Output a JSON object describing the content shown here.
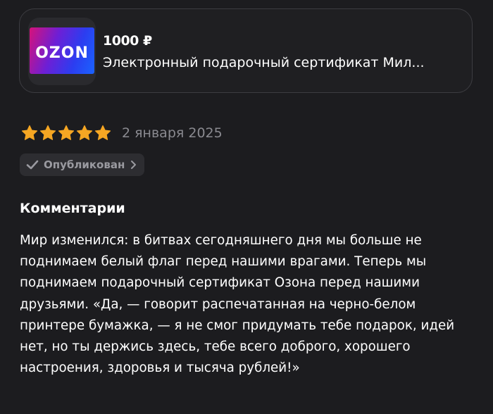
{
  "product": {
    "logo_text": "OZON",
    "price": "1000 ₽",
    "title": "Электронный подарочный сертификат Мил..."
  },
  "review": {
    "rating": 5,
    "rating_max": 5,
    "star_color": "#f5a623",
    "date": "2 января 2025",
    "status": {
      "icon": "check-icon",
      "label": "Опубликован",
      "arrow": "chevron-right-icon"
    }
  },
  "comments": {
    "heading": "Комментарии",
    "text": "Мир изменился: в битвах сегодняшнего дня мы больше не поднимаем белый флаг перед нашими врагами. Теперь мы поднимаем подарочный сертификат Озона перед нашими друзьями. «Да, — говорит распечатанная на черно-белом принтере бумажка, — я не смог придумать тебе подарок, идей нет, но ты держись здесь, тебе всего доброго, хорошего настроения, здоровья и тысяча рублей!»"
  }
}
